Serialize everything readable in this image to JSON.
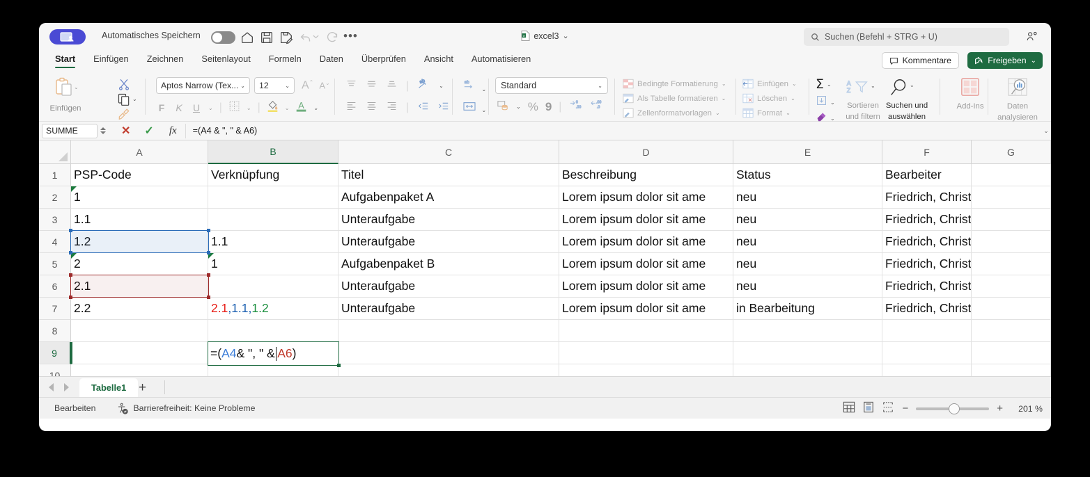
{
  "window": {
    "titlebar": {
      "present_badge_icon": "screen-share-icon",
      "autosave_label": "Automatisches Speichern",
      "autosave_state": "off",
      "home_icon": "home-icon",
      "save_icon": "save-icon",
      "save_as_icon": "save-as-icon",
      "undo_icon": "undo-icon",
      "undo_chevron_icon": "chevron-down-icon",
      "redo_icon": "redo-icon",
      "more_icon": "more-horizontal-icon",
      "document_title": "excel3",
      "document_chevron": "⌄",
      "file_icon": "xlsx-file-icon"
    },
    "search": {
      "icon": "search-icon",
      "placeholder": "Suchen (Befehl + STRG + U)",
      "value": ""
    },
    "peek_icon": "presence-icon"
  },
  "ribbon_tabs": {
    "items": [
      {
        "label": "Start",
        "active": true
      },
      {
        "label": "Einfügen",
        "active": false
      },
      {
        "label": "Zeichnen",
        "active": false
      },
      {
        "label": "Seitenlayout",
        "active": false
      },
      {
        "label": "Formeln",
        "active": false
      },
      {
        "label": "Daten",
        "active": false
      },
      {
        "label": "Überprüfen",
        "active": false
      },
      {
        "label": "Ansicht",
        "active": false
      },
      {
        "label": "Automatisieren",
        "active": false
      }
    ],
    "comments_label": "Kommentare",
    "comments_icon": "comment-icon",
    "share_label": "Freigeben",
    "share_icon": "share-icon",
    "share_chevron": "⌄",
    "accent_color": "#1e6b41"
  },
  "ribbon": {
    "clipboard": {
      "paste_label": "Einfügen",
      "paste_icon": "clipboard-icon",
      "paste_chevron": "⌄",
      "cut_icon": "scissors-icon",
      "copy_icon": "copy-icon",
      "copy_chevron": "⌄",
      "format_painter_icon": "format-painter-icon"
    },
    "font": {
      "family_value": "Aptos Narrow (Tex...",
      "family_chevron": "⌄",
      "size_value": "12",
      "size_chevron": "⌄",
      "grow_font_icon": "increase-font-size-icon",
      "shrink_font_icon": "decrease-font-size-icon",
      "bold_label": "F",
      "italic_label": "K",
      "underline_label": "U",
      "underline_chevron": "⌄",
      "borders_icon": "borders-icon",
      "borders_chevron": "⌄",
      "fill_color_icon": "fill-color-icon",
      "fill_chevron": "⌄",
      "font_color_icon": "font-color-icon",
      "font_color_chevron": "⌄"
    },
    "alignment": {
      "align_top_icon": "align-top-icon",
      "align_middle_icon": "align-middle-icon",
      "align_bottom_icon": "align-bottom-icon",
      "orientation_icon": "text-orientation-icon",
      "orientation_chevron": "⌄",
      "align_left_icon": "align-left-icon",
      "align_center_icon": "align-center-icon",
      "align_right_icon": "align-right-icon",
      "decrease_indent_icon": "decrease-indent-icon",
      "increase_indent_icon": "increase-indent-icon",
      "wrap_text_icon": "wrap-text-icon",
      "wrap_chevron": "⌄",
      "merge_cells_icon": "merge-cells-icon",
      "merge_chevron": "⌄"
    },
    "number": {
      "format_value": "Standard",
      "format_chevron": "⌄",
      "currency_icon": "currency-icon",
      "currency_chevron": "⌄",
      "percent_label": "%",
      "thousands_label": "9",
      "increase_decimal_icon": "increase-decimal-icon",
      "decrease_decimal_icon": "decrease-decimal-icon"
    },
    "styles": {
      "conditional_formatting_label": "Bedingte Formatierung",
      "conditional_formatting_icon": "conditional-formatting-icon",
      "format_as_table_label": "Als Tabelle formatieren",
      "format_as_table_icon": "format-as-table-icon",
      "cell_styles_label": "Zellenformatvorlagen",
      "cell_styles_icon": "cell-styles-icon",
      "chevron": "⌄"
    },
    "cells": {
      "insert_label": "Einfügen",
      "insert_icon": "insert-cells-icon",
      "delete_label": "Löschen",
      "delete_icon": "delete-cells-icon",
      "format_label": "Format",
      "format_icon": "format-cells-icon",
      "chevron": "⌄"
    },
    "editing": {
      "autosum_icon": "autosum-icon",
      "autosum_chevron": "⌄",
      "fill_icon": "fill-down-icon",
      "fill_chevron": "⌄",
      "clear_icon": "clear-icon",
      "clear_chevron": "⌄",
      "sort_filter_label": "Sortieren\nund filtern",
      "sort_filter_line1": "Sortieren",
      "sort_filter_line2": "und filtern",
      "sort_filter_icon": "sort-filter-icon",
      "sort_filter_chevron": "⌄",
      "find_select_line1": "Suchen und",
      "find_select_line2": "auswählen",
      "find_select_icon": "magnifier-icon",
      "find_select_chevron": "⌄"
    },
    "addins": {
      "addins_label": "Add-Ins",
      "addins_icon": "addins-icon",
      "analyze_data_line1": "Daten",
      "analyze_data_line2": "analysieren",
      "analyze_data_icon": "analyze-data-icon"
    }
  },
  "formula_bar": {
    "name_box_value": "SUMME",
    "cancel_icon": "cancel-x-icon",
    "accept_icon": "accept-check-icon",
    "function_icon": "fx-icon",
    "formula_value": "=(A4 & \", \" & A6)",
    "expand_chevron": "⌄"
  },
  "grid": {
    "column_headers": [
      "A",
      "B",
      "C",
      "D",
      "E",
      "F",
      "G"
    ],
    "selected_column": "B",
    "row_headers": [
      "1",
      "2",
      "3",
      "4",
      "5",
      "6",
      "7",
      "8",
      "9",
      "10"
    ],
    "selected_row": "9",
    "rows": [
      {
        "num": "1",
        "cells": {
          "A": "PSP-Code",
          "B": "Verknüpfung",
          "C": "Titel",
          "D": "Beschreibung",
          "E": "Status",
          "F": "Bearbeiter",
          "G": ""
        }
      },
      {
        "num": "2",
        "cells": {
          "A": "1",
          "B": "",
          "C": "Aufgabenpaket A",
          "D": "Lorem ipsum dolor sit ame",
          "E": "neu",
          "F": "Friedrich, Christoph",
          "G": ""
        },
        "error_flags": [
          "A"
        ]
      },
      {
        "num": "3",
        "cells": {
          "A": "1.1",
          "B": "",
          "C": "Unteraufgabe",
          "D": "Lorem ipsum dolor sit ame",
          "E": "neu",
          "F": "Friedrich, Christoph",
          "G": ""
        }
      },
      {
        "num": "4",
        "cells": {
          "A": "1.2",
          "B": "1.1",
          "C": "Unteraufgabe",
          "D": "Lorem ipsum dolor sit ame",
          "E": "neu",
          "F": "Friedrich, Christoph",
          "G": ""
        }
      },
      {
        "num": "5",
        "cells": {
          "A": "2",
          "B": "1",
          "C": "Aufgabenpaket B",
          "D": "Lorem ipsum dolor sit ame",
          "E": "neu",
          "F": "Friedrich, Christoph",
          "G": ""
        },
        "error_flags": [
          "A",
          "B"
        ]
      },
      {
        "num": "6",
        "cells": {
          "A": "2.1",
          "B": "",
          "C": "Unteraufgabe",
          "D": "Lorem ipsum dolor sit ame",
          "E": "neu",
          "F": "Friedrich, Christoph",
          "G": ""
        }
      },
      {
        "num": "7",
        "cells": {
          "A": "2.2",
          "B": "2.1, 1.1, 1.2",
          "C": "Unteraufgabe",
          "D": "Lorem ipsum dolor sit ame",
          "E": "in Bearbeitung",
          "F": "Friedrich, Christoph",
          "G": ""
        }
      },
      {
        "num": "8",
        "cells": {
          "A": "",
          "B": "",
          "C": "",
          "D": "",
          "E": "",
          "F": "",
          "G": ""
        }
      },
      {
        "num": "9",
        "cells": {
          "A": "",
          "B": "",
          "C": "",
          "D": "",
          "E": "",
          "F": "",
          "G": ""
        }
      },
      {
        "num": "10",
        "cells": {
          "A": "",
          "B": "",
          "C": "",
          "D": "",
          "E": "",
          "F": "",
          "G": ""
        }
      }
    ],
    "b7_segments": [
      {
        "text": "2.1",
        "color": "#e8201a"
      },
      {
        "text": ", ",
        "color": "#1b5fb0"
      },
      {
        "text": "1.1",
        "color": "#1b5fb0"
      },
      {
        "text": ", ",
        "color": "#1b5fb0"
      },
      {
        "text": "1.2",
        "color": "#1e9141"
      }
    ],
    "editing_cell": {
      "address": "B9",
      "segments": [
        {
          "text": "=(",
          "color": "#111111"
        },
        {
          "text": "A4",
          "color": "#3b7dd8"
        },
        {
          "text": " & \", \" & ",
          "color": "#111111"
        },
        {
          "text": "A6",
          "color": "#c0392b"
        },
        {
          "text": ")",
          "color": "#111111"
        }
      ],
      "caret_before": "A6"
    },
    "reference_highlights": [
      {
        "cell": "A4",
        "color": "#2b6cb8",
        "label": "blue-reference-a4"
      },
      {
        "cell": "A6",
        "color": "#9e2b2b",
        "label": "red-reference-a6"
      }
    ]
  },
  "sheet_tabs": {
    "prev_icon": "nav-prev-icon",
    "next_icon": "nav-next-icon",
    "tabs": [
      {
        "label": "Tabelle1",
        "active": true
      }
    ],
    "add_label": "+"
  },
  "status_bar": {
    "mode": "Bearbeiten",
    "accessibility_icon": "accessibility-icon",
    "accessibility_text": "Barrierefreiheit: Keine Probleme",
    "normal_view_icon": "normal-view-icon",
    "page_layout_icon": "page-layout-icon",
    "page_break_icon": "page-break-icon",
    "zoom_out_label": "−",
    "zoom_in_label": "+",
    "zoom_level": "201 %"
  }
}
